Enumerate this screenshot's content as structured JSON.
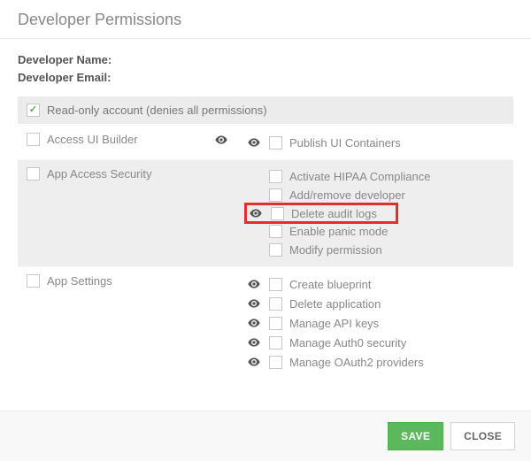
{
  "header": {
    "title": "Developer Permissions"
  },
  "dev": {
    "name_label": "Developer Name:",
    "email_label": "Developer Email:"
  },
  "readonly": {
    "label": "Read-only account (denies all permissions)",
    "checked": true
  },
  "groups": [
    {
      "alt": false,
      "left_label": "Access UI Builder",
      "left_eye": true,
      "items": [
        {
          "eye": true,
          "label": "Publish UI Containers",
          "highlight": false
        }
      ]
    },
    {
      "alt": true,
      "left_label": "App Access Security",
      "left_eye": false,
      "items": [
        {
          "eye": false,
          "label": "Activate HIPAA Compliance",
          "highlight": false
        },
        {
          "eye": false,
          "label": "Add/remove developer",
          "highlight": false
        },
        {
          "eye": true,
          "label": "Delete audit logs",
          "highlight": true
        },
        {
          "eye": false,
          "label": "Enable panic mode",
          "highlight": false
        },
        {
          "eye": false,
          "label": "Modify permission",
          "highlight": false
        }
      ]
    },
    {
      "alt": false,
      "left_label": "App Settings",
      "left_eye": false,
      "items": [
        {
          "eye": true,
          "label": "Create blueprint",
          "highlight": false
        },
        {
          "eye": true,
          "label": "Delete application",
          "highlight": false
        },
        {
          "eye": true,
          "label": "Manage API keys",
          "highlight": false
        },
        {
          "eye": true,
          "label": "Manage Auth0 security",
          "highlight": false
        },
        {
          "eye": true,
          "label": "Manage OAuth2 providers",
          "highlight": false
        }
      ]
    }
  ],
  "footer": {
    "save_label": "SAVE",
    "close_label": "CLOSE"
  }
}
